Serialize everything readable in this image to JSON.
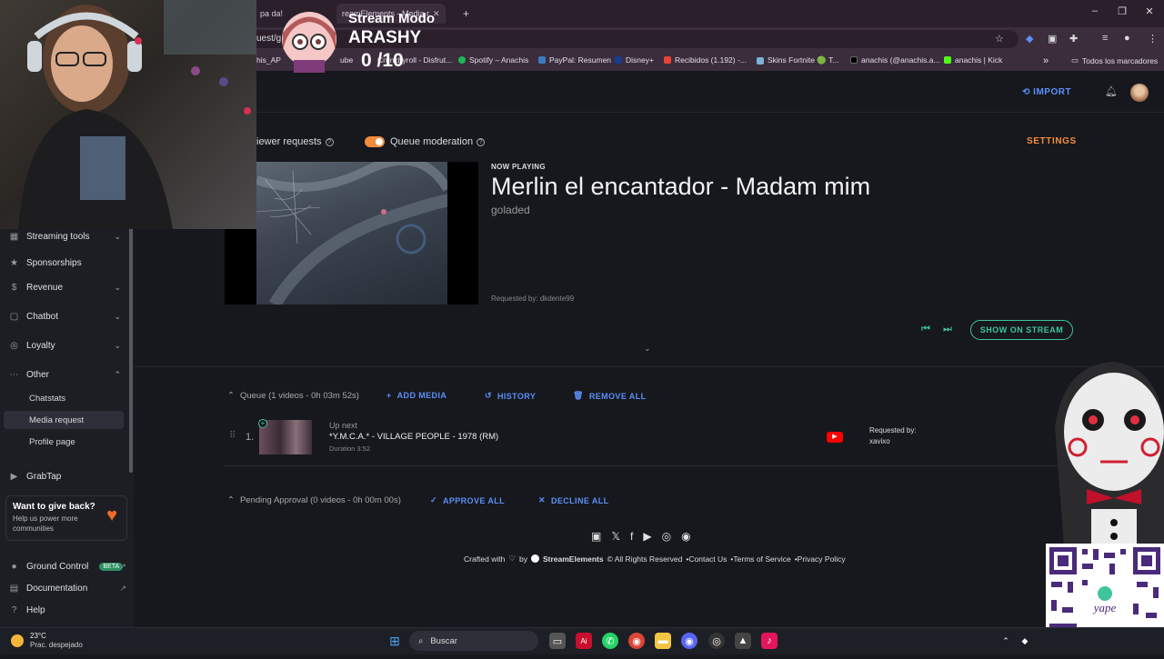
{
  "browser": {
    "tabs": [
      {
        "label": "pa da!"
      },
      {
        "label": "reamElements - Media r"
      }
    ],
    "new_tab": "+",
    "url": "uest/g",
    "window": {
      "minimize": "–",
      "restore": "❐",
      "close": "✕"
    },
    "bookmarks": [
      {
        "label": "his_AP",
        "color": "#888888"
      },
      {
        "label": "ube",
        "color": "#ff0000"
      },
      {
        "label": "Crunchyroll - Disfrut...",
        "color": "#f47521"
      },
      {
        "label": "Spotify – Anachis",
        "color": "#1db954"
      },
      {
        "label": "PayPal: Resumen",
        "color": "#3b7bbf"
      },
      {
        "label": "Disney+",
        "color": "#1a3d8f"
      },
      {
        "label": "Recibidos (1.192) -...",
        "color": "#ea4335"
      },
      {
        "label": "Skins Fortnite 🟢 T...",
        "color": "#7fb3d5"
      },
      {
        "label": "anachis (@anachis.a...",
        "color": "#000000"
      },
      {
        "label": "anachis | Kick",
        "color": "#53fc18"
      }
    ],
    "bookmarks_more": "»",
    "all_bookmarks": "Todos los marcadores"
  },
  "header": {
    "import_label": "IMPORT",
    "settings_label": "SETTINGS"
  },
  "sidebar": {
    "items": [
      {
        "label": "Streaming tools",
        "icon": "grid-icon",
        "chevron": "⌄"
      },
      {
        "label": "Sponsorships",
        "icon": "star-icon"
      },
      {
        "label": "Revenue",
        "icon": "dollar-icon",
        "chevron": "⌄"
      },
      {
        "label": "Chatbot",
        "icon": "chat-icon",
        "chevron": "⌄"
      },
      {
        "label": "Loyalty",
        "icon": "loyalty-icon",
        "chevron": "⌄"
      },
      {
        "label": "Other",
        "icon": "more-icon",
        "chevron": "⌃"
      }
    ],
    "sub_items": [
      {
        "label": "Chatstats"
      },
      {
        "label": "Media request"
      },
      {
        "label": "Profile page"
      }
    ],
    "grabtap": "GrabTap",
    "give_back": {
      "title": "Want to give back?",
      "text": "Help us power more communities"
    },
    "ground_control": "Ground Control",
    "beta": "BETA",
    "documentation": "Documentation",
    "help": "Help"
  },
  "controls": {
    "viewer_requests": "iewer requests",
    "queue_moderation": "Queue moderation",
    "queue_moderation_on": true
  },
  "now_playing": {
    "label": "NOW PLAYING",
    "title": "Merlin el encantador - Madam mim",
    "channel": "goladed",
    "requested_by": "Requested by: dkdente99",
    "show_on_stream": "SHOW ON STREAM"
  },
  "queue": {
    "header": "Queue (1 videos - 0h 03m 52s)",
    "add_media": "ADD MEDIA",
    "history": "HISTORY",
    "remove_all": "REMOVE ALL",
    "items": [
      {
        "index": "1.",
        "up_next": "Up next",
        "title": "*Y.M.C.A.* - VILLAGE PEOPLE - 1978 (RM)",
        "duration": "Duration 3:52",
        "requested_by_label": "Requested by:",
        "requested_by": "xavixo"
      }
    ]
  },
  "pending": {
    "header": "Pending Approval (0 videos - 0h 00m 00s)",
    "approve_all": "APPROVE ALL",
    "decline_all": "DECLINE ALL"
  },
  "footer": {
    "crafted": "Crafted with",
    "by": "by",
    "brand": "StreamElements",
    "rights": "© All Rights Reserved",
    "contact": "•Contact Us",
    "terms": "•Terms of Service",
    "privacy": "•Privacy Policy"
  },
  "overlay": {
    "title": "Stream Modo",
    "name": "ARASHY",
    "count": "0 /10",
    "qr_brand": "yape"
  },
  "taskbar": {
    "temp": "23°C",
    "weather": "Prac. despejado",
    "search": "Buscar"
  }
}
